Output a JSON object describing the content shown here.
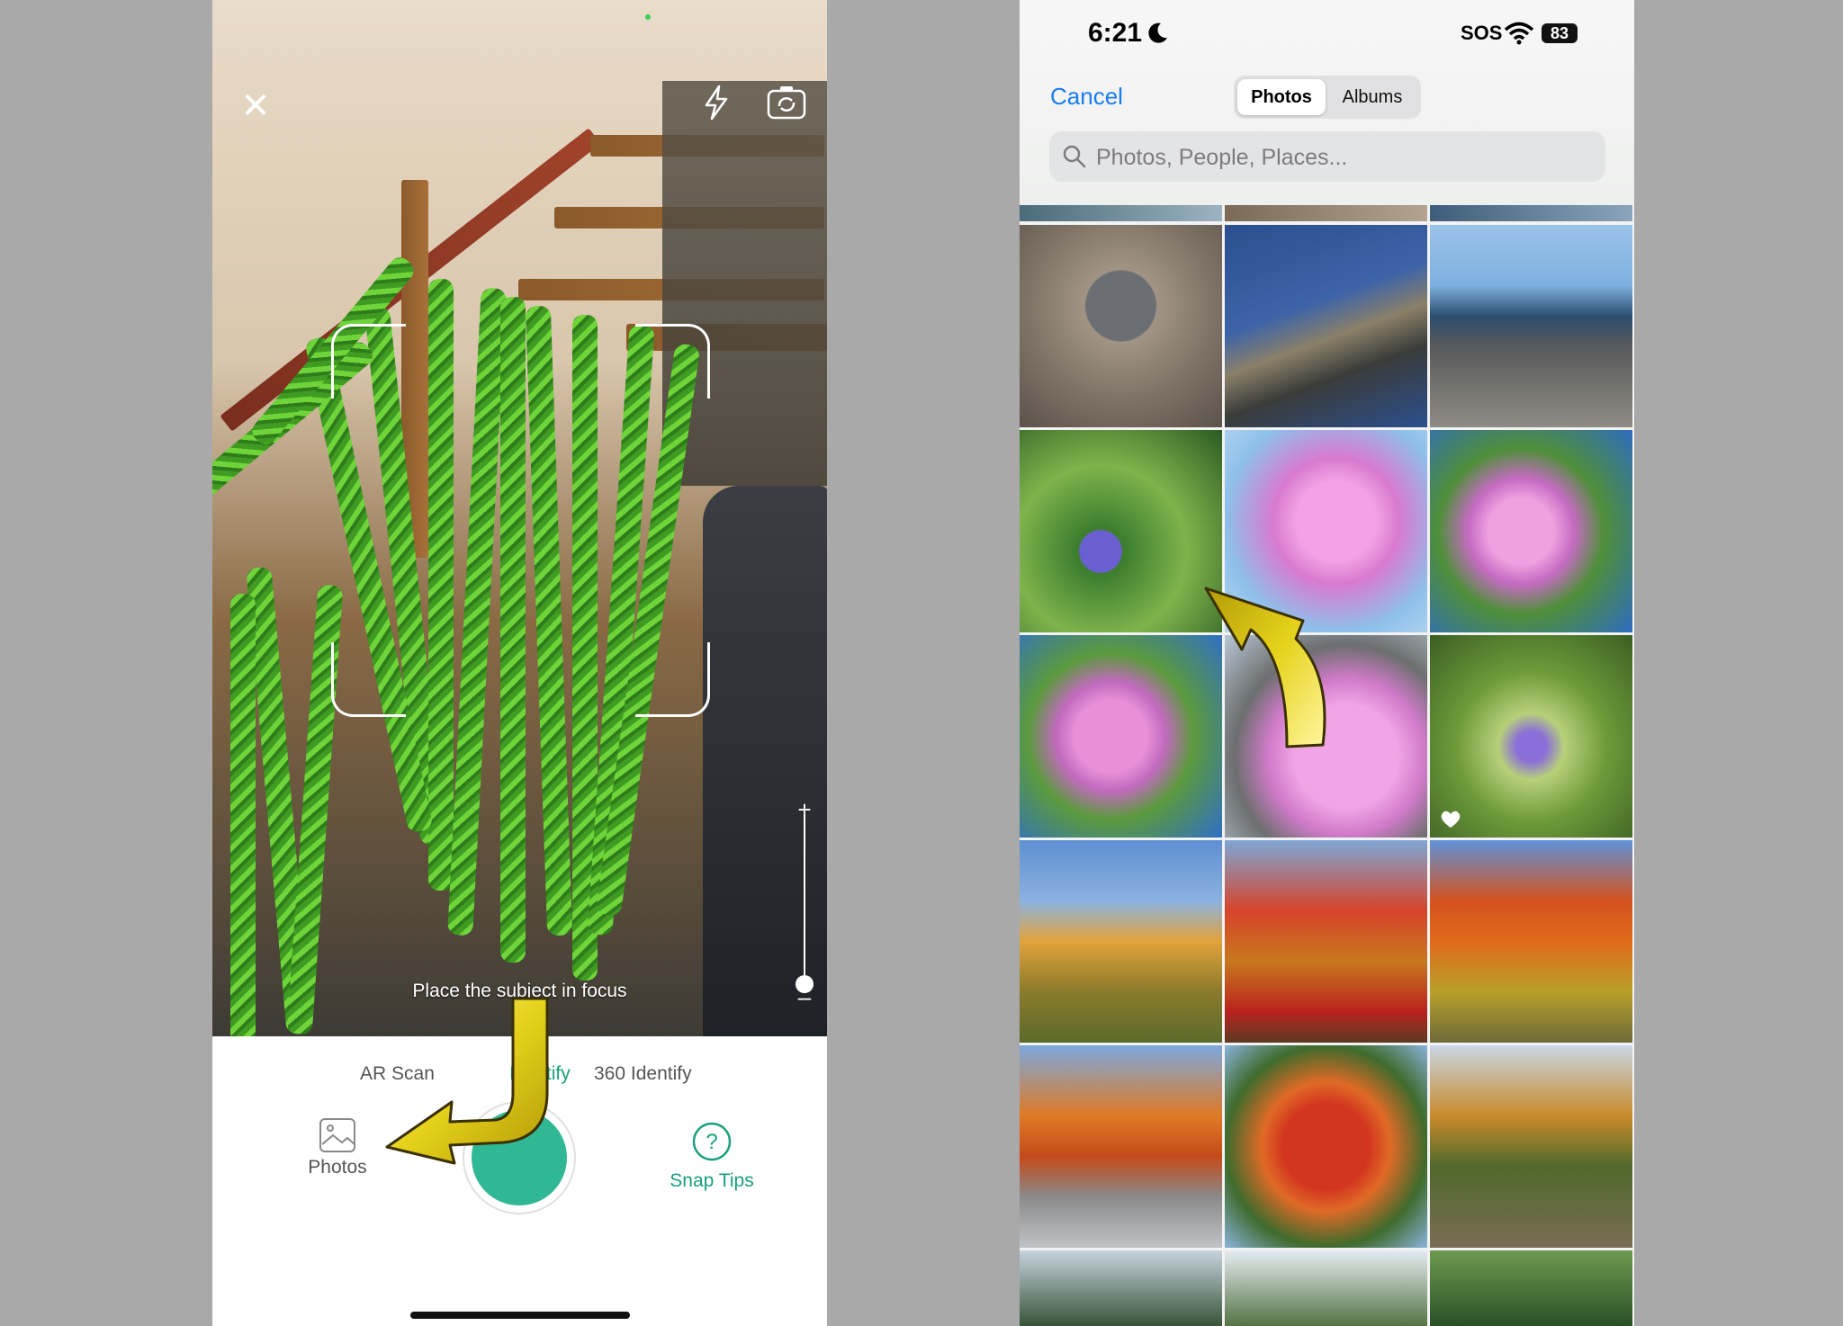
{
  "left_phone": {
    "focus_hint": "Place the subject in focus",
    "modes": [
      "AR Scan",
      "Identify",
      "360 Identify"
    ],
    "active_mode_index": 1,
    "photos_button": "Photos",
    "snap_tips_button": "Snap Tips",
    "icons": {
      "close": "close-icon",
      "flash": "flash-icon",
      "flip": "flip-camera-icon",
      "photos": "gallery-icon",
      "tips": "question-icon"
    },
    "zoom_level": 0,
    "accent_color": "#2fb893"
  },
  "right_phone": {
    "status": {
      "time": "6:21",
      "sos": "SOS",
      "battery": "83"
    },
    "cancel_label": "Cancel",
    "segments": [
      "Photos",
      "Albums"
    ],
    "selected_segment": "Photos",
    "search_placeholder": "Photos, People, Places...",
    "photos": [
      {
        "subject": "child on rocks"
      },
      {
        "subject": "rock in water"
      },
      {
        "subject": "child on boardwalk"
      },
      {
        "subject": "purple wildflowers"
      },
      {
        "subject": "pink foxglove"
      },
      {
        "subject": "pink foxglove"
      },
      {
        "subject": "pink foxglove"
      },
      {
        "subject": "pink foxglove"
      },
      {
        "subject": "purple comfrey",
        "favorite": true
      },
      {
        "subject": "autumn trees"
      },
      {
        "subject": "autumn trees"
      },
      {
        "subject": "autumn trees"
      },
      {
        "subject": "autumn road bridge"
      },
      {
        "subject": "autumn red tree"
      },
      {
        "subject": "autumn forest path"
      },
      {
        "subject": "trees"
      },
      {
        "subject": "trees"
      },
      {
        "subject": "trees"
      }
    ],
    "link_color": "#1a7cf0"
  }
}
